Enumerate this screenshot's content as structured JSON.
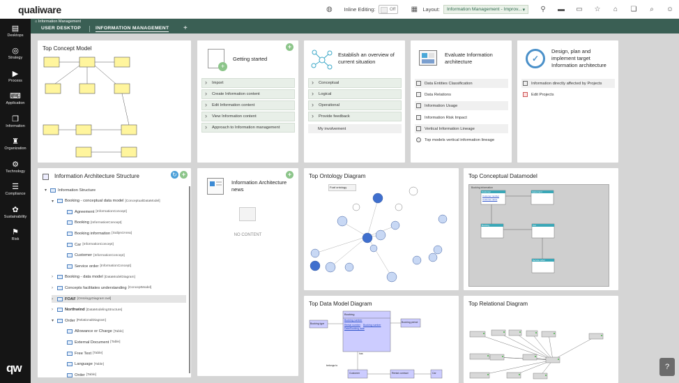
{
  "brand": {
    "logo_text": "qualiware",
    "mark_text": "qw"
  },
  "topbar": {
    "inline_editing_label": "Inline Editing:",
    "inline_editing_value": "Off",
    "layout_label": "Layout:",
    "layout_value": "Information Management - Improv..."
  },
  "sidebar": {
    "items": [
      {
        "label": "Desktops",
        "icon": "desktops-icon",
        "glyph": "▤"
      },
      {
        "label": "Strategy",
        "icon": "target-icon",
        "glyph": "◎"
      },
      {
        "label": "Process",
        "icon": "process-icon",
        "glyph": "▶"
      },
      {
        "label": "Application",
        "icon": "application-icon",
        "glyph": "⌨"
      },
      {
        "label": "Information",
        "icon": "information-icon",
        "glyph": "❐"
      },
      {
        "label": "Organization",
        "icon": "organization-icon",
        "glyph": "♜"
      },
      {
        "label": "Technology",
        "icon": "technology-icon",
        "glyph": "⚙"
      },
      {
        "label": "Compliance",
        "icon": "compliance-icon",
        "glyph": "☰"
      },
      {
        "label": "Sustainability",
        "icon": "sustainability-icon",
        "glyph": "✿"
      },
      {
        "label": "Risk",
        "icon": "risk-icon",
        "glyph": "⚑"
      }
    ]
  },
  "nav": {
    "breadcrumb": "Information Management",
    "tabs": [
      {
        "label": "USER DESKTOP"
      },
      {
        "label": "INFORMATION MANAGEMENT"
      }
    ],
    "add_tab": "+"
  },
  "cards": {
    "top_concept_model": {
      "title": "Top Concept Model"
    },
    "getting_started": {
      "title": "Getting started",
      "items": [
        "Import",
        "Create Information content",
        "Edit Information content",
        "View Information content",
        "Approach to Information management"
      ]
    },
    "overview": {
      "title_line1": "Establish an overview of",
      "title_line2": "current situation",
      "items": [
        "Conceptual",
        "Logical",
        "Operational",
        "Provide feedback"
      ],
      "extra_item": "My involvement"
    },
    "evaluate": {
      "title_line1": "Evaluate Information",
      "title_line2": "architecture",
      "items": [
        "Data Entities Classification",
        "Data Relations",
        "Information Usage",
        "Information Risk Impact",
        "Vertical Information Lineage",
        "Top models vertical information lineage"
      ]
    },
    "design": {
      "title_line1": "Design, plan and",
      "title_line2": "implement target",
      "title_line3": "Information architecture",
      "items": [
        "Information directly affected by Projects",
        "Edit Projects"
      ]
    },
    "structure": {
      "title": "Information Architecture Structure",
      "rows": [
        {
          "label": "Information Structure",
          "type": ""
        },
        {
          "label": "Booking - conceptual data model",
          "type": "[ConceptualDataModel]"
        },
        {
          "label": "Agreement",
          "type": "[InformationConcept]"
        },
        {
          "label": "Booking",
          "type": "[InformationConcept]"
        },
        {
          "label": "Booking information",
          "type": "[SubjectArea]"
        },
        {
          "label": "Car",
          "type": "[InformationConcept]"
        },
        {
          "label": "Customer",
          "type": "[InformationConcept]"
        },
        {
          "label": "Service order",
          "type": "[InformationConcept]"
        },
        {
          "label": "Booking - data model",
          "type": "[DataModelDiagram]"
        },
        {
          "label": "Concepts facilitates understanding",
          "type": "[ConceptModel]"
        },
        {
          "label": "FOAF",
          "type": "[OntologyDiagram:owl]"
        },
        {
          "label": "Northwind",
          "type": "[DataModelingStructure]"
        },
        {
          "label": "Order",
          "type": "[RelationalDiagram]"
        },
        {
          "label": "Allowance or Charge",
          "type": "[Table]"
        },
        {
          "label": "External Document",
          "type": "[Table]"
        },
        {
          "label": "Free Text",
          "type": "[Table]"
        },
        {
          "label": "Language",
          "type": "[Table]"
        },
        {
          "label": "Order",
          "type": "[Table]"
        }
      ]
    },
    "news": {
      "title_line1": "Information Architecture",
      "title_line2": "news",
      "empty": "NO CONTENT"
    },
    "ontology": {
      "title": "Top Ontology Diagram",
      "legend_title": "Foaf ontology"
    },
    "conceptual_dm": {
      "title": "Top Conceptual Datamodel",
      "frame_label": "Booking information",
      "entities": [
        "Customer",
        "Agreement",
        "Booking",
        "Car",
        "Service order"
      ],
      "fields": [
        "Customer number",
        "Customer name"
      ]
    },
    "data_model": {
      "title": "Top Data Model Diagram",
      "entities": [
        "Booking",
        "Booking type",
        "Booking period",
        "Customer",
        "Rental contract",
        "Car"
      ],
      "fields": [
        "Booking number",
        "Rental number",
        "Booking number",
        "Date/Booking date"
      ],
      "relations": [
        "has",
        "belongs to"
      ]
    },
    "relational": {
      "title": "Top Relational Diagram"
    }
  }
}
